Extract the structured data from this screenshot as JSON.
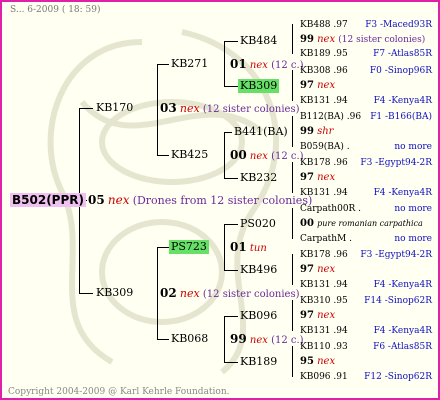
{
  "header": "S... 6-2009 ( 18: 59)",
  "footer": "Copyright 2004-2009 @ Karl Kehrle Foundation.",
  "root": {
    "id": "B502(PPR)",
    "year": "05",
    "nex": "nex",
    "note": "(Drones from 12 sister colonies)"
  },
  "g1": [
    {
      "id": "KB170",
      "year": "03",
      "nex": "nex",
      "note": "(12 sister colonies)"
    },
    {
      "id": "KB309",
      "year": "02",
      "nex": "nex",
      "note": "(12 sister colonies)"
    }
  ],
  "g2": [
    {
      "id": "KB271",
      "year": "01",
      "nex": "nex",
      "note": "(12 c.)"
    },
    {
      "id": "KB425",
      "year": "00",
      "nex": "nex",
      "note": "(12 c.)"
    },
    {
      "id": "PS723",
      "year": "01",
      "nex": "tun",
      "note": ""
    },
    {
      "id": "KB068",
      "year": "99",
      "nex": "nex",
      "note": "(12 c.)"
    }
  ],
  "g3": [
    {
      "id": "KB484",
      "year": "99",
      "nex": "nex",
      "note": "(12 sister colonies)"
    },
    {
      "id": "KB309",
      "year": "97",
      "nex": "nex",
      "note": ""
    },
    {
      "id": "B441(BA)",
      "year": "99",
      "nex": "shr",
      "note": ""
    },
    {
      "id": "KB232",
      "year": "97",
      "nex": "nex",
      "note": ""
    },
    {
      "id": "PS020",
      "year": "00",
      "nex": "pure romanian carpathica",
      "note": ""
    },
    {
      "id": "KB496",
      "year": "97",
      "nex": "nex",
      "note": ""
    },
    {
      "id": "KB096",
      "year": "97",
      "nex": "nex",
      "note": ""
    },
    {
      "id": "KB189",
      "year": "95",
      "nex": "nex",
      "note": ""
    }
  ],
  "g4": [
    {
      "left": "KB488 .97",
      "right": "F3 -Maced93R"
    },
    {
      "left": "KB189 .95",
      "right": "F7 -Atlas85R"
    },
    {
      "left": "KB308 .96",
      "right": "F0 -Sinop96R"
    },
    {
      "left": "KB131 .94",
      "right": "F4 -Kenya4R"
    },
    {
      "left": "B112(BA) .96",
      "right": "F1 -B166(BA)"
    },
    {
      "left": "B059(BA) .",
      "right": "no more"
    },
    {
      "left": "KB178 .96",
      "right": "F3 -Egypt94-2R"
    },
    {
      "left": "KB131 .94",
      "right": "F4 -Kenya4R"
    },
    {
      "left": "Carpath00R .",
      "right": "no more"
    },
    {
      "left": "CarpathM .",
      "right": "no more"
    },
    {
      "left": "KB178 .96",
      "right": "F3 -Egypt94-2R"
    },
    {
      "left": "KB131 .94",
      "right": "F4 -Kenya4R"
    },
    {
      "left": "KB310 .95",
      "right": "F14 -Sinop62R"
    },
    {
      "left": "KB131 .94",
      "right": "F4 -Kenya4R"
    },
    {
      "left": "KB110 .93",
      "right": "F6 -Atlas85R"
    },
    {
      "left": "KB096 .91",
      "right": "F12 -Sinop62R"
    }
  ]
}
